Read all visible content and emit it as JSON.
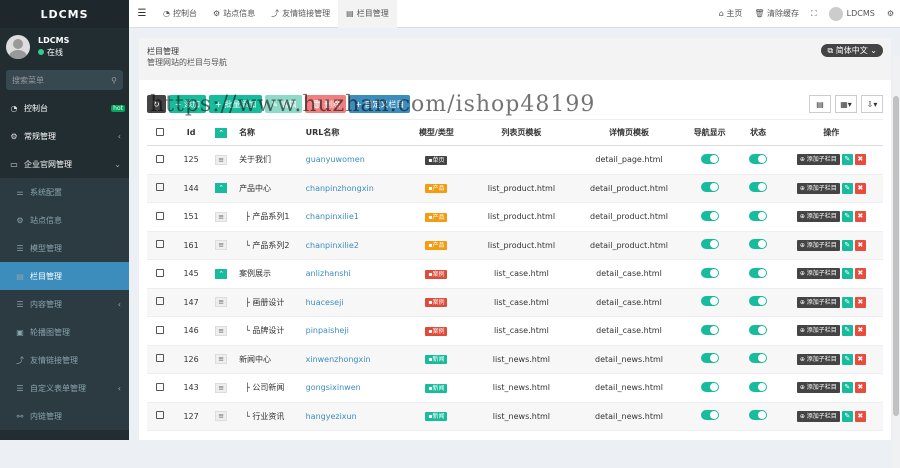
{
  "app": {
    "brand": "LDCMS"
  },
  "user": {
    "name": "LDCMS",
    "status": "在线"
  },
  "search": {
    "placeholder": "搜索菜单"
  },
  "sidebar": {
    "items": [
      {
        "label": "控制台",
        "icon": "dashboard-icon",
        "badge": "hot"
      },
      {
        "label": "常规管理",
        "icon": "cogs-icon"
      },
      {
        "label": "企业官网管理",
        "icon": "desktop-icon"
      },
      {
        "label": "系统配置",
        "icon": "sliders-icon"
      },
      {
        "label": "站点信息",
        "icon": "gear-icon"
      },
      {
        "label": "模型管理",
        "icon": "list-icon"
      },
      {
        "label": "栏目管理",
        "icon": "file-icon"
      },
      {
        "label": "内容管理",
        "icon": "list-icon"
      },
      {
        "label": "轮播图管理",
        "icon": "image-icon"
      },
      {
        "label": "友情链接管理",
        "icon": "share-icon"
      },
      {
        "label": "自定义表单管理",
        "icon": "list-icon"
      },
      {
        "label": "内链管理",
        "icon": "link-icon"
      }
    ]
  },
  "tabs": [
    {
      "label": "控制台",
      "icon": "dashboard-icon"
    },
    {
      "label": "站点信息",
      "icon": "gear-icon"
    },
    {
      "label": "友情链接管理",
      "icon": "share-icon"
    },
    {
      "label": "栏目管理",
      "icon": "file-icon"
    }
  ],
  "topright": {
    "home": "主页",
    "clear": "清除缓存",
    "user": "LDCMS"
  },
  "page": {
    "title": "栏目管理",
    "subtitle": "管理网站的栏目与导航",
    "lang": "简体中文"
  },
  "toolbar": {
    "add": "添加",
    "batch_add": "批量添加",
    "edit": "编辑",
    "delete": "删除",
    "custom": "自定义栏目"
  },
  "watermark": "https://www.huzhan.com/ishop48199",
  "table": {
    "headers": [
      "",
      "Id",
      "",
      "名称",
      "URL名称",
      "模型/类型",
      "列表页模板",
      "详情页模板",
      "导航显示",
      "状态",
      "操作"
    ],
    "add_sub_label": "添加子栏目",
    "rows": [
      {
        "id": "125",
        "name": "关于我们",
        "url": "guanyuwomen",
        "type": "单页",
        "kind": "single",
        "list": "",
        "detail": "detail_page.html",
        "indent": 0,
        "dark": false
      },
      {
        "id": "144",
        "name": "产品中心",
        "url": "chanpinzhongxin",
        "type": "产品",
        "kind": "product",
        "list": "list_product.html",
        "detail": "detail_product.html",
        "indent": 0,
        "dark": true
      },
      {
        "id": "151",
        "name": "├ 产品系列1",
        "url": "chanpinxilie1",
        "type": "产品",
        "kind": "product",
        "list": "list_product.html",
        "detail": "detail_product.html",
        "indent": 1,
        "dark": false
      },
      {
        "id": "161",
        "name": "└ 产品系列2",
        "url": "chanpinxilie2",
        "type": "产品",
        "kind": "product",
        "list": "list_product.html",
        "detail": "detail_product.html",
        "indent": 1,
        "dark": false
      },
      {
        "id": "145",
        "name": "案例展示",
        "url": "anlizhanshi",
        "type": "案例",
        "kind": "case",
        "list": "list_case.html",
        "detail": "detail_case.html",
        "indent": 0,
        "dark": true
      },
      {
        "id": "147",
        "name": "├ 画册设计",
        "url": "huaceseji",
        "type": "案例",
        "kind": "case",
        "list": "list_case.html",
        "detail": "detail_case.html",
        "indent": 1,
        "dark": false
      },
      {
        "id": "146",
        "name": "└ 品牌设计",
        "url": "pinpaisheji",
        "type": "案例",
        "kind": "case",
        "list": "list_case.html",
        "detail": "detail_case.html",
        "indent": 1,
        "dark": false
      },
      {
        "id": "126",
        "name": "新闻中心",
        "url": "xinwenzhongxin",
        "type": "新闻",
        "kind": "news",
        "list": "list_news.html",
        "detail": "detail_news.html",
        "indent": 0,
        "dark": false
      },
      {
        "id": "143",
        "name": "├ 公司新闻",
        "url": "gongsixinwen",
        "type": "新闻",
        "kind": "news",
        "list": "list_news.html",
        "detail": "detail_news.html",
        "indent": 1,
        "dark": false
      },
      {
        "id": "127",
        "name": "└ 行业资讯",
        "url": "hangyezixun",
        "type": "新闻",
        "kind": "news",
        "list": "list_news.html",
        "detail": "detail_news.html",
        "indent": 1,
        "dark": false
      }
    ]
  }
}
